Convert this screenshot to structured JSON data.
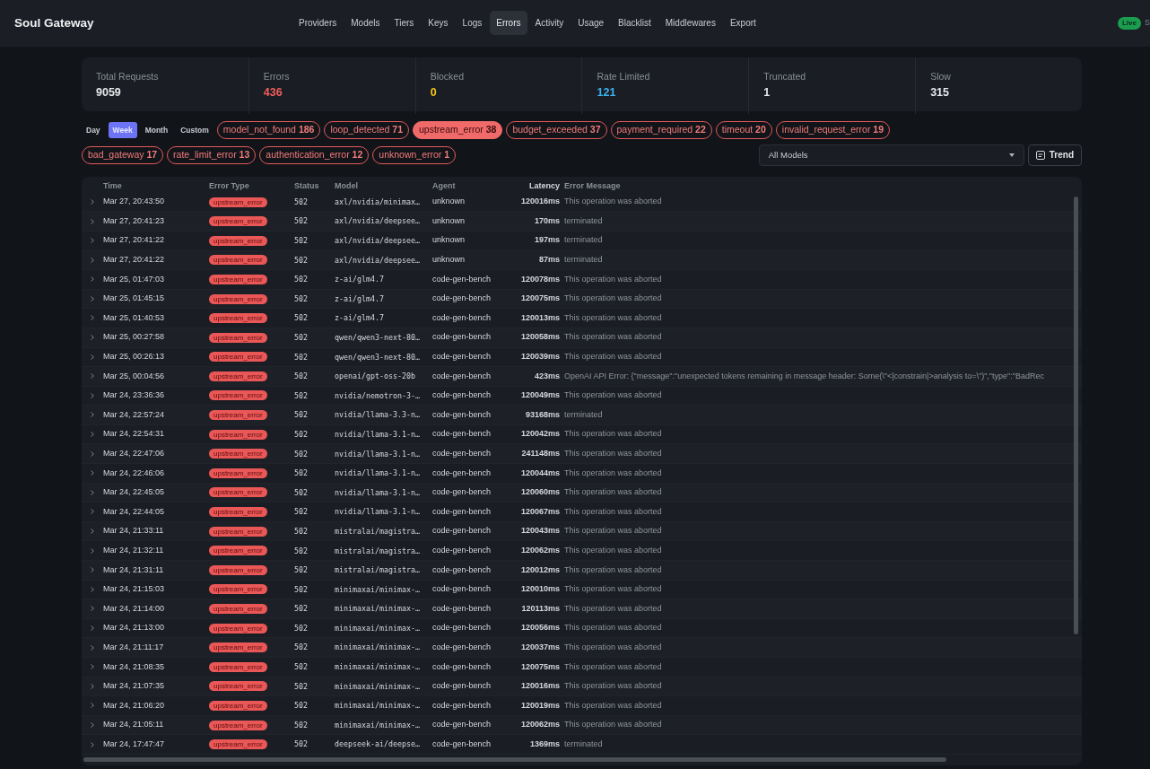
{
  "app": {
    "title": "Soul Gateway",
    "live_badge": "Live",
    "status_text": "S"
  },
  "nav": [
    {
      "label": "Providers",
      "selected": false
    },
    {
      "label": "Models",
      "selected": false
    },
    {
      "label": "Tiers",
      "selected": false
    },
    {
      "label": "Keys",
      "selected": false
    },
    {
      "label": "Logs",
      "selected": false
    },
    {
      "label": "Errors",
      "selected": true
    },
    {
      "label": "Activity",
      "selected": false
    },
    {
      "label": "Usage",
      "selected": false
    },
    {
      "label": "Blacklist",
      "selected": false
    },
    {
      "label": "Middlewares",
      "selected": false
    },
    {
      "label": "Export",
      "selected": false
    }
  ],
  "stats": [
    {
      "label": "Total Requests",
      "value": "9059",
      "color": "#e6e8ec"
    },
    {
      "label": "Errors",
      "value": "436",
      "color": "#f25f5c"
    },
    {
      "label": "Blocked",
      "value": "0",
      "color": "#f5c518"
    },
    {
      "label": "Rate Limited",
      "value": "121",
      "color": "#3bb4f2"
    },
    {
      "label": "Truncated",
      "value": "1",
      "color": "#e6e8ec"
    },
    {
      "label": "Slow",
      "value": "315",
      "color": "#e6e8ec"
    }
  ],
  "ranges": [
    {
      "label": "Day",
      "selected": false
    },
    {
      "label": "Week",
      "selected": true
    },
    {
      "label": "Month",
      "selected": false
    },
    {
      "label": "Custom",
      "selected": false
    }
  ],
  "error_types": [
    {
      "label": "model_not_found",
      "count": "186",
      "selected": false
    },
    {
      "label": "loop_detected",
      "count": "71",
      "selected": false
    },
    {
      "label": "upstream_error",
      "count": "38",
      "selected": true
    },
    {
      "label": "budget_exceeded",
      "count": "37",
      "selected": false
    },
    {
      "label": "payment_required",
      "count": "22",
      "selected": false
    },
    {
      "label": "timeout",
      "count": "20",
      "selected": false
    },
    {
      "label": "invalid_request_error",
      "count": "19",
      "selected": false
    },
    {
      "label": "bad_gateway",
      "count": "17",
      "selected": false
    },
    {
      "label": "rate_limit_error",
      "count": "13",
      "selected": false
    },
    {
      "label": "authentication_error",
      "count": "12",
      "selected": false
    },
    {
      "label": "unknown_error",
      "count": "1",
      "selected": false
    }
  ],
  "model_filter": {
    "value": "All Models"
  },
  "trend_button": "Trend",
  "table": {
    "columns": [
      "Time",
      "Error Type",
      "Status",
      "Model",
      "Agent",
      "Latency",
      "Error Message"
    ],
    "rows": [
      [
        "Mar 27, 20:43:50",
        "upstream_error",
        "502",
        "axl/nvidia/minimax…",
        "unknown",
        "120016ms",
        "This operation was aborted"
      ],
      [
        "Mar 27, 20:41:23",
        "upstream_error",
        "502",
        "axl/nvidia/deepsee…",
        "unknown",
        "170ms",
        "terminated"
      ],
      [
        "Mar 27, 20:41:22",
        "upstream_error",
        "502",
        "axl/nvidia/deepsee…",
        "unknown",
        "197ms",
        "terminated"
      ],
      [
        "Mar 27, 20:41:22",
        "upstream_error",
        "502",
        "axl/nvidia/deepsee…",
        "unknown",
        "87ms",
        "terminated"
      ],
      [
        "Mar 25, 01:47:03",
        "upstream_error",
        "502",
        "z-ai/glm4.7",
        "code-gen-bench",
        "120078ms",
        "This operation was aborted"
      ],
      [
        "Mar 25, 01:45:15",
        "upstream_error",
        "502",
        "z-ai/glm4.7",
        "code-gen-bench",
        "120075ms",
        "This operation was aborted"
      ],
      [
        "Mar 25, 01:40:53",
        "upstream_error",
        "502",
        "z-ai/glm4.7",
        "code-gen-bench",
        "120013ms",
        "This operation was aborted"
      ],
      [
        "Mar 25, 00:27:58",
        "upstream_error",
        "502",
        "qwen/qwen3-next-80…",
        "code-gen-bench",
        "120058ms",
        "This operation was aborted"
      ],
      [
        "Mar 25, 00:26:13",
        "upstream_error",
        "502",
        "qwen/qwen3-next-80…",
        "code-gen-bench",
        "120039ms",
        "This operation was aborted"
      ],
      [
        "Mar 25, 00:04:56",
        "upstream_error",
        "502",
        "openai/gpt-oss-20b",
        "code-gen-bench",
        "423ms",
        "OpenAI API Error: {\"message\":\"unexpected tokens remaining in message header: Some(\\\"<|constrain|>analysis to=\\\")\",\"type\":\"BadRec"
      ],
      [
        "Mar 24, 23:36:36",
        "upstream_error",
        "502",
        "nvidia/nemotron-3-…",
        "code-gen-bench",
        "120049ms",
        "This operation was aborted"
      ],
      [
        "Mar 24, 22:57:24",
        "upstream_error",
        "502",
        "nvidia/llama-3.3-n…",
        "code-gen-bench",
        "93168ms",
        "terminated"
      ],
      [
        "Mar 24, 22:54:31",
        "upstream_error",
        "502",
        "nvidia/llama-3.1-n…",
        "code-gen-bench",
        "120042ms",
        "This operation was aborted"
      ],
      [
        "Mar 24, 22:47:06",
        "upstream_error",
        "502",
        "nvidia/llama-3.1-n…",
        "code-gen-bench",
        "241148ms",
        "This operation was aborted"
      ],
      [
        "Mar 24, 22:46:06",
        "upstream_error",
        "502",
        "nvidia/llama-3.1-n…",
        "code-gen-bench",
        "120044ms",
        "This operation was aborted"
      ],
      [
        "Mar 24, 22:45:05",
        "upstream_error",
        "502",
        "nvidia/llama-3.1-n…",
        "code-gen-bench",
        "120060ms",
        "This operation was aborted"
      ],
      [
        "Mar 24, 22:44:05",
        "upstream_error",
        "502",
        "nvidia/llama-3.1-n…",
        "code-gen-bench",
        "120067ms",
        "This operation was aborted"
      ],
      [
        "Mar 24, 21:33:11",
        "upstream_error",
        "502",
        "mistralai/magistra…",
        "code-gen-bench",
        "120043ms",
        "This operation was aborted"
      ],
      [
        "Mar 24, 21:32:11",
        "upstream_error",
        "502",
        "mistralai/magistra…",
        "code-gen-bench",
        "120062ms",
        "This operation was aborted"
      ],
      [
        "Mar 24, 21:31:11",
        "upstream_error",
        "502",
        "mistralai/magistra…",
        "code-gen-bench",
        "120012ms",
        "This operation was aborted"
      ],
      [
        "Mar 24, 21:15:03",
        "upstream_error",
        "502",
        "minimaxai/minimax-…",
        "code-gen-bench",
        "120010ms",
        "This operation was aborted"
      ],
      [
        "Mar 24, 21:14:00",
        "upstream_error",
        "502",
        "minimaxai/minimax-…",
        "code-gen-bench",
        "120113ms",
        "This operation was aborted"
      ],
      [
        "Mar 24, 21:13:00",
        "upstream_error",
        "502",
        "minimaxai/minimax-…",
        "code-gen-bench",
        "120056ms",
        "This operation was aborted"
      ],
      [
        "Mar 24, 21:11:17",
        "upstream_error",
        "502",
        "minimaxai/minimax-…",
        "code-gen-bench",
        "120037ms",
        "This operation was aborted"
      ],
      [
        "Mar 24, 21:08:35",
        "upstream_error",
        "502",
        "minimaxai/minimax-…",
        "code-gen-bench",
        "120075ms",
        "This operation was aborted"
      ],
      [
        "Mar 24, 21:07:35",
        "upstream_error",
        "502",
        "minimaxai/minimax-…",
        "code-gen-bench",
        "120016ms",
        "This operation was aborted"
      ],
      [
        "Mar 24, 21:06:20",
        "upstream_error",
        "502",
        "minimaxai/minimax-…",
        "code-gen-bench",
        "120019ms",
        "This operation was aborted"
      ],
      [
        "Mar 24, 21:05:11",
        "upstream_error",
        "502",
        "minimaxai/minimax-…",
        "code-gen-bench",
        "120062ms",
        "This operation was aborted"
      ],
      [
        "Mar 24, 17:47:47",
        "upstream_error",
        "502",
        "deepseek-ai/deepse…",
        "code-gen-bench",
        "1369ms",
        "terminated"
      ]
    ]
  }
}
